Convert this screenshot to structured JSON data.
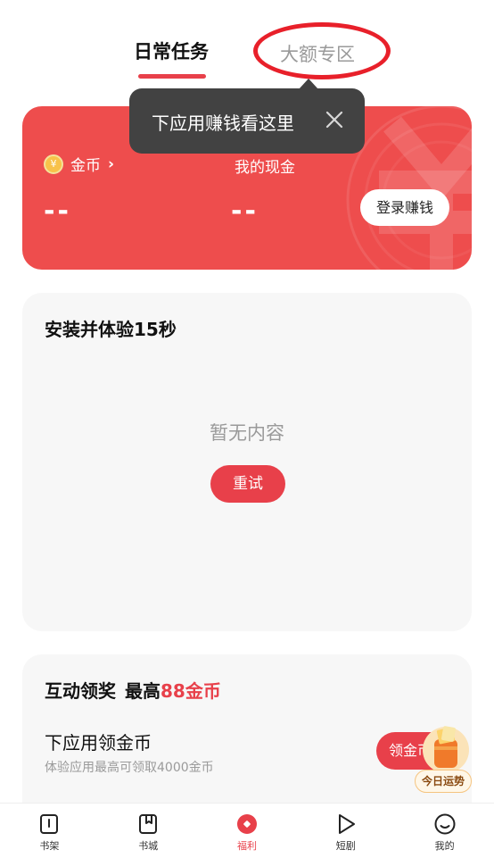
{
  "tabs": {
    "daily": "日常任务",
    "big": "大额专区"
  },
  "tooltip": {
    "text": "下应用赚钱看这里"
  },
  "wallet": {
    "coin_label": "金币",
    "coin_value": "--",
    "cash_label": "我的现金",
    "cash_value": "--",
    "login_button": "登录赚钱",
    "coin_symbol": "¥"
  },
  "install": {
    "title": "安装并体验15秒",
    "empty_text": "暂无内容",
    "retry_button": "重试"
  },
  "interact": {
    "title": "互动领奖",
    "max_prefix": "最高",
    "max_amount": "88金币",
    "app_title": "下应用领金币",
    "app_subtitle": "体验应用最高可领取4000金币",
    "claim_button": "领金币"
  },
  "fortune": {
    "label": "今日运势"
  },
  "nav": {
    "items": [
      {
        "label": "书架",
        "icon": "bookshelf-icon"
      },
      {
        "label": "书城",
        "icon": "bookstore-icon"
      },
      {
        "label": "福利",
        "icon": "welfare-icon"
      },
      {
        "label": "短剧",
        "icon": "play-icon"
      },
      {
        "label": "我的",
        "icon": "profile-icon"
      }
    ],
    "active_index": 2
  },
  "colors": {
    "accent": "#e8404a",
    "card_red": "#ee4d4d",
    "tooltip_bg": "#424242"
  }
}
